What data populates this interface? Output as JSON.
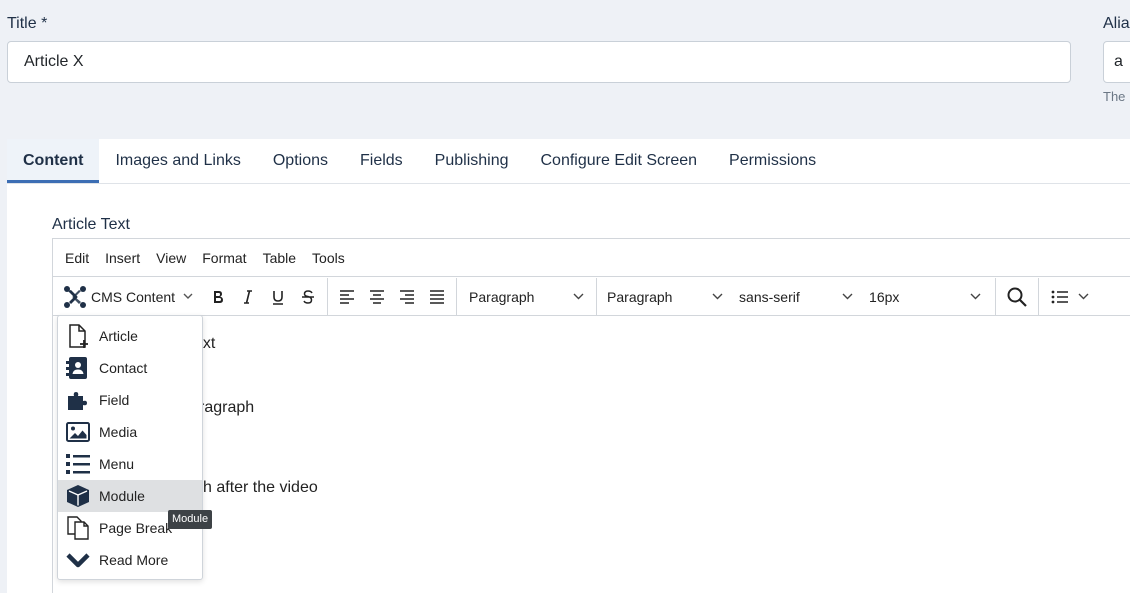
{
  "title_field": {
    "label": "Title *",
    "value": "Article X"
  },
  "alias_field": {
    "label": "Alias",
    "value": "a",
    "help": "The"
  },
  "tabs": [
    {
      "label": "Content"
    },
    {
      "label": "Images and Links"
    },
    {
      "label": "Options"
    },
    {
      "label": "Fields"
    },
    {
      "label": "Publishing"
    },
    {
      "label": "Configure Edit Screen"
    },
    {
      "label": "Permissions"
    }
  ],
  "editor": {
    "label": "Article Text",
    "menu": [
      "Edit",
      "Insert",
      "View",
      "Format",
      "Table",
      "Tools"
    ],
    "toolbar": {
      "cms_content": "CMS Content",
      "block_format": "Paragraph",
      "style_format": "Paragraph",
      "font_family": "sans-serif",
      "font_size": "16px"
    },
    "content_fragments": [
      "ext",
      "ragraph",
      "h after the video"
    ]
  },
  "cms_dropdown": {
    "items": [
      {
        "label": "Article",
        "icon": "file-plus-icon"
      },
      {
        "label": "Contact",
        "icon": "address-card-icon"
      },
      {
        "label": "Field",
        "icon": "puzzle-piece-icon"
      },
      {
        "label": "Media",
        "icon": "image-icon"
      },
      {
        "label": "Menu",
        "icon": "list-icon"
      },
      {
        "label": "Module",
        "icon": "cube-icon"
      },
      {
        "label": "Page Break",
        "icon": "copy-icon"
      },
      {
        "label": "Read More",
        "icon": "chevron-down-icon"
      }
    ],
    "hovered": "Module",
    "tooltip": "Module"
  },
  "colors": {
    "accent": "#3c6eb4",
    "background": "#eef1f6",
    "hover": "#dee0e2"
  }
}
